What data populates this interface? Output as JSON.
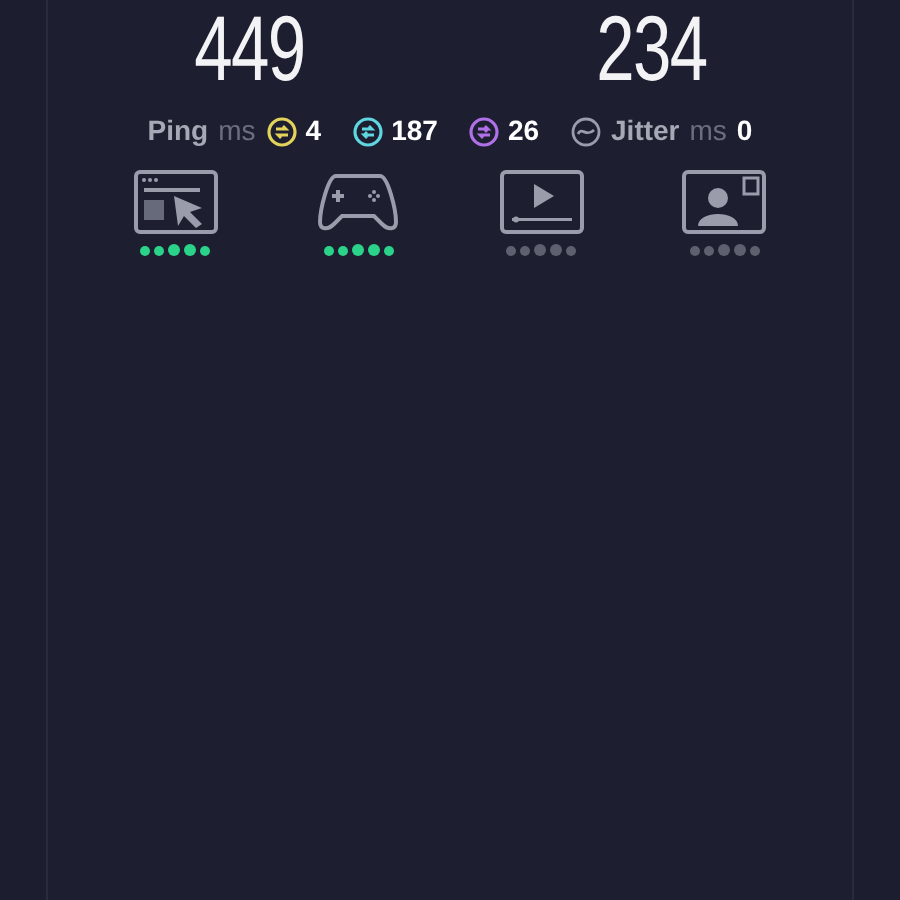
{
  "speeds": [
    "449",
    "234"
  ],
  "ping": {
    "label": "Ping",
    "unit": "ms",
    "values": [
      {
        "kind": "idle",
        "value": "4",
        "color": "#e3d35a"
      },
      {
        "kind": "download",
        "value": "187",
        "color": "#5fd6e0"
      },
      {
        "kind": "upload",
        "value": "26",
        "color": "#b070e8"
      }
    ]
  },
  "jitter": {
    "label": "Jitter",
    "unit": "ms",
    "value": "0"
  },
  "ratings": [
    {
      "kind": "browsing",
      "stars": 5
    },
    {
      "kind": "gaming",
      "stars": 5
    },
    {
      "kind": "video",
      "stars": 0
    },
    {
      "kind": "chat",
      "stars": 0
    }
  ]
}
